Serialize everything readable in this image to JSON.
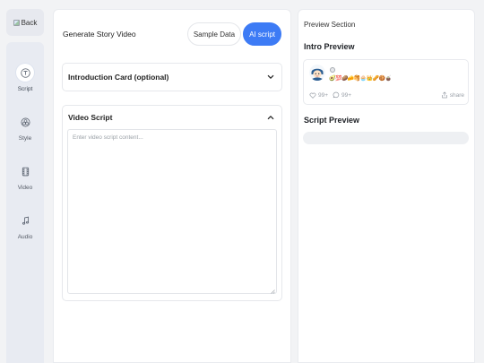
{
  "back": {
    "label": "Back"
  },
  "sidebar": {
    "items": [
      {
        "label": "Script",
        "icon": "text-t-icon",
        "active": true
      },
      {
        "label": "Style",
        "icon": "palette-icon",
        "active": false
      },
      {
        "label": "Video",
        "icon": "film-icon",
        "active": false
      },
      {
        "label": "Audio",
        "icon": "music-note-icon",
        "active": false
      }
    ]
  },
  "editor": {
    "title": "Generate Story Video",
    "sample_data_label": "Sample Data",
    "ai_script_label": "AI script",
    "intro_card": {
      "title": "Introduction Card (optional)",
      "expanded": false
    },
    "video_script": {
      "title": "Video Script",
      "expanded": true,
      "value": "",
      "placeholder": "Enter video script content..."
    }
  },
  "preview": {
    "section_label": "Preview Section",
    "intro_heading": "Intro Preview",
    "intro_card": {
      "emoji_text": "🥑💯🥔🧀🥞🧁👑🥜🍪🧉",
      "likes": "99+",
      "comments": "99+",
      "share_label": "share"
    },
    "script_heading": "Script Preview"
  },
  "colors": {
    "accent": "#3d7bf5",
    "sidebar_bg": "#e8ebf2",
    "page_bg": "#f2f3f5"
  }
}
